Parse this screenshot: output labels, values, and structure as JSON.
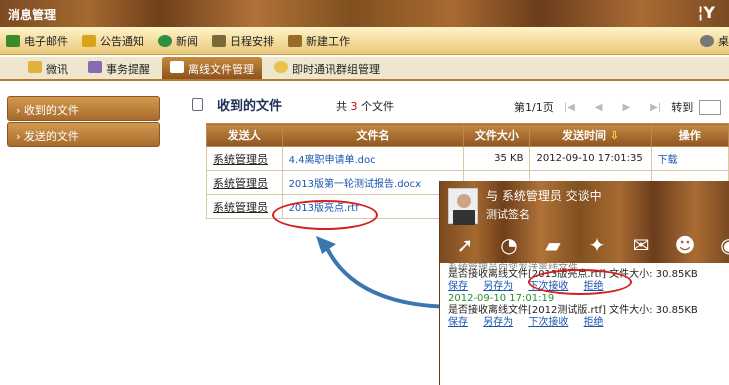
{
  "app": {
    "title": "消息管理",
    "logo": "¦Y"
  },
  "menu": [
    {
      "label": "电子邮件",
      "icon": "email-icon",
      "color": "#3a8a2a"
    },
    {
      "label": "公告通知",
      "icon": "announcement-icon",
      "color": "#d9a21a"
    },
    {
      "label": "新闻",
      "icon": "news-icon",
      "color": "#2f8f40"
    },
    {
      "label": "日程安排",
      "icon": "calendar-icon",
      "color": "#7a6a3a"
    },
    {
      "label": "新建工作",
      "icon": "new-work-icon",
      "color": "#9a6a2a"
    }
  ],
  "menu_right": "桌",
  "tabs": [
    {
      "label": "微讯",
      "icon": "weixun-icon"
    },
    {
      "label": "事务提醒",
      "icon": "reminder-icon"
    },
    {
      "label": "离线文件管理",
      "icon": "file-icon",
      "active": true
    },
    {
      "label": "即时通讯群组管理",
      "icon": "group-icon"
    }
  ],
  "sidebar": {
    "received": "收到的文件",
    "sent": "发送的文件"
  },
  "page": {
    "title": "收到的文件",
    "count_prefix": "共",
    "count": "3",
    "count_suffix": "个文件",
    "page_info": "第1/1页",
    "goto": "转到",
    "page_unit": "第"
  },
  "table": {
    "headers": [
      "发送人",
      "文件名",
      "文件大小",
      "发送时间",
      "操作"
    ],
    "rows": [
      {
        "sender": "系统管理员",
        "file": "4.4离职申请单.doc",
        "size": "35 KB",
        "time": "2012-09-10 17:01:35",
        "action": "下载"
      },
      {
        "sender": "系统管理员",
        "file": "2013版第一轮测试报告.docx",
        "size": "",
        "time": "",
        "action": ""
      },
      {
        "sender": "系统管理员",
        "file": "2013版亮点.rtf",
        "size": "",
        "time": "",
        "action": ""
      }
    ]
  },
  "chat": {
    "header": "与  系统管理员  交谈中",
    "signature": "测试签名",
    "partial_line": "系统管理员向您发送离线文件",
    "msg1": "是否接收离线文件[2013版亮点.rtf] 文件大小:  30.85KB",
    "actions": [
      "保存",
      "另存为",
      "下次接收",
      "拒绝"
    ],
    "timestamp": "2012-09-10 17:01:19",
    "msg2": "是否接收离线文件[2012测试版.rtf] 文件大小:  30.85KB"
  },
  "colors": {
    "accent": "#a86a31",
    "highlight": "#d3201e",
    "arrow": "#3a76b0"
  }
}
